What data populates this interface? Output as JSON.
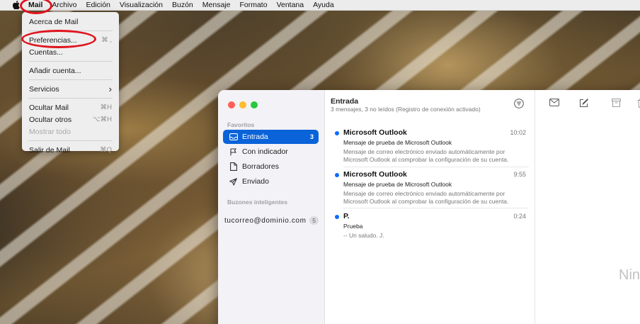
{
  "menubar": {
    "items": [
      {
        "label": "Mail",
        "bold": true
      },
      {
        "label": "Archivo"
      },
      {
        "label": "Edición"
      },
      {
        "label": "Visualización"
      },
      {
        "label": "Buzón"
      },
      {
        "label": "Mensaje"
      },
      {
        "label": "Formato"
      },
      {
        "label": "Ventana"
      },
      {
        "label": "Ayuda"
      }
    ],
    "icon": "apple-logo-icon"
  },
  "mail_menu": {
    "about": "Acerca de Mail",
    "preferences": "Preferencias...",
    "preferences_shortcut": "⌘ ,",
    "accounts": "Cuentas...",
    "add_account": "Añadir cuenta...",
    "services": "Servicios",
    "services_arrow": "›",
    "hide_mail": "Ocultar Mail",
    "hide_mail_shortcut": "⌘H",
    "hide_others": "Ocultar otros",
    "hide_others_shortcut": "⌥⌘H",
    "show_all": "Mostrar todo",
    "quit": "Salir de Mail",
    "quit_shortcut": "⌘Q"
  },
  "annotation_color": "#e0141e",
  "window": {
    "traffic_colors": [
      "#ff5f57",
      "#febc2e",
      "#28c840"
    ],
    "sidebar": {
      "favorites_heading": "Favoritos",
      "items": [
        {
          "label": "Entrada",
          "count": "3",
          "icon": "inbox-icon"
        },
        {
          "label": "Con indicador",
          "icon": "flag-icon"
        },
        {
          "label": "Borradores",
          "icon": "draft-icon"
        },
        {
          "label": "Enviado",
          "icon": "sent-icon"
        }
      ],
      "smart_heading": "Buzones inteligentes",
      "account_label": "tucorreo@dominio.com",
      "account_count": "5",
      "accent": "#0a63d8"
    },
    "list": {
      "title": "Entrada",
      "subtitle": "3 mensajes, 3 no leídos (Registro de conexión activado)",
      "messages": [
        {
          "from": "Microsoft Outlook",
          "time": "10:02",
          "subject": "Mensaje de prueba de Microsoft Outlook",
          "preview": "Mensaje de correo electrónico enviado automáticamente por Microsoft Outlook al comprobar la configuración de su cuenta."
        },
        {
          "from": "Microsoft Outlook",
          "time": "9:55",
          "subject": "Mensaje de prueba de Microsoft Outlook",
          "preview": "Mensaje de correo electrónico enviado automáticamente por Microsoft Outlook al comprobar la configuración de su cuenta."
        },
        {
          "from": "P.",
          "time": "0:24",
          "subject": "Prueba",
          "preview": "-- Un saludo. J."
        }
      ]
    },
    "viewer": {
      "no_selection": "Nin",
      "toolbar_icons": [
        "envelope-icon",
        "compose-icon",
        "archive-icon",
        "trash-icon"
      ]
    }
  }
}
